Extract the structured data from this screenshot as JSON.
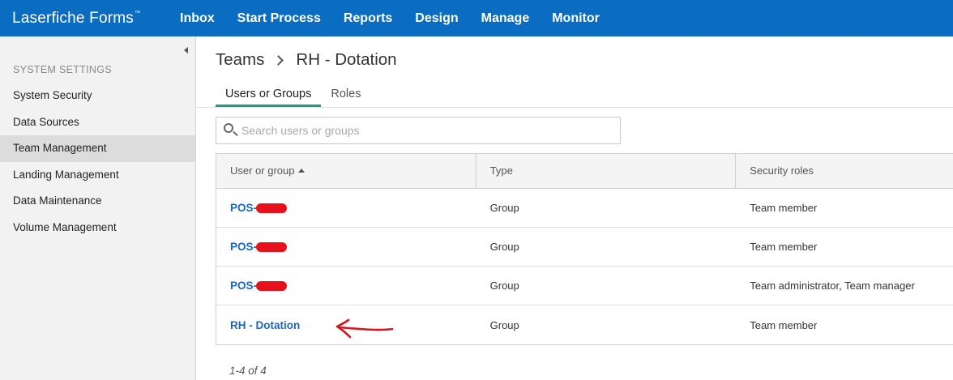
{
  "app": {
    "brand": "Laserfiche Forms",
    "brand_mark": "™"
  },
  "nav": {
    "items": [
      "Inbox",
      "Start Process",
      "Reports",
      "Design",
      "Manage",
      "Monitor"
    ]
  },
  "sidebar": {
    "heading": "SYSTEM SETTINGS",
    "items": [
      {
        "label": "System Security",
        "active": false
      },
      {
        "label": "Data Sources",
        "active": false
      },
      {
        "label": "Team Management",
        "active": true
      },
      {
        "label": "Landing Management",
        "active": false
      },
      {
        "label": "Data Maintenance",
        "active": false
      },
      {
        "label": "Volume Management",
        "active": false
      }
    ]
  },
  "breadcrumb": {
    "parent": "Teams",
    "current": "RH - Dotation"
  },
  "tabs": [
    {
      "label": "Users or Groups",
      "active": true
    },
    {
      "label": "Roles",
      "active": false
    }
  ],
  "search": {
    "placeholder": "Search users or groups",
    "value": ""
  },
  "table": {
    "columns": [
      "User or group",
      "Type",
      "Security roles"
    ],
    "sort_column": "User or group",
    "sort_direction": "ascending",
    "rows": [
      {
        "name": "POS-",
        "redacted": true,
        "type": "Group",
        "roles": "Team member"
      },
      {
        "name": "POS-",
        "redacted": true,
        "type": "Group",
        "roles": "Team member"
      },
      {
        "name": "POS-",
        "redacted": true,
        "type": "Group",
        "roles": "Team administrator, Team manager"
      },
      {
        "name": "RH - Dotation",
        "redacted": false,
        "type": "Group",
        "roles": "Team member"
      }
    ]
  },
  "pager": {
    "text": "1-4 of 4"
  },
  "colors": {
    "topbar": "#0a6dc2",
    "active_tab_underline": "#1f9e8a",
    "link": "#1a66c0",
    "redaction": "#e8101a",
    "annotation": "#d8141c"
  }
}
